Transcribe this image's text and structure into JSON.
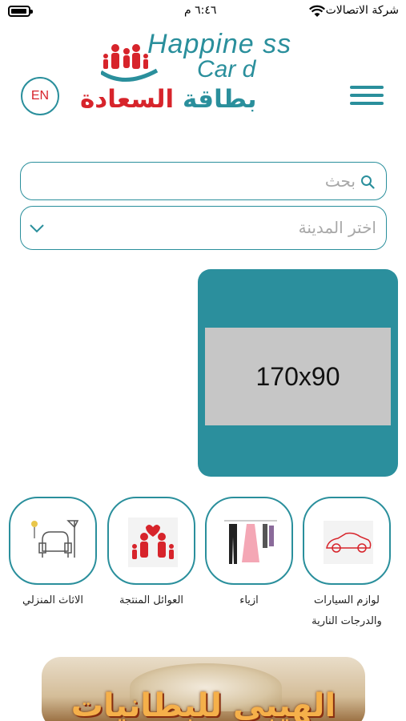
{
  "status_bar": {
    "carrier": "شركة الاتصالات",
    "time": "٦:٤٦ م"
  },
  "header": {
    "logo_line1": "Happine ss",
    "logo_line2": "Car d",
    "logo_arabic_prefix": "بطاقة",
    "logo_arabic_suffix": "السعادة",
    "language_button": "EN",
    "menu_icon": "hamburger-icon"
  },
  "search": {
    "placeholder": "بحث",
    "icon": "search-icon"
  },
  "city_select": {
    "label": "اختر المدينة",
    "icon": "chevron-down-icon"
  },
  "banner": {
    "placeholder_text": "170x90"
  },
  "categories": [
    {
      "label_line1": "لوازم السيارات",
      "label_line2": "والدرجات النارية",
      "icon": "car-icon"
    },
    {
      "label_line1": "ازياء",
      "label_line2": "",
      "icon": "clothes-icon"
    },
    {
      "label_line1": "العوائل المنتجة",
      "label_line2": "",
      "icon": "family-icon"
    },
    {
      "label_line1": "الاثاث المنزلي",
      "label_line2": "",
      "icon": "furniture-icon"
    }
  ],
  "promo": {
    "text": "الهيبي للبطانيات"
  },
  "colors": {
    "accent": "#2a8f9c",
    "brand_red": "#d7242b",
    "banner": "#2b8f9d"
  }
}
